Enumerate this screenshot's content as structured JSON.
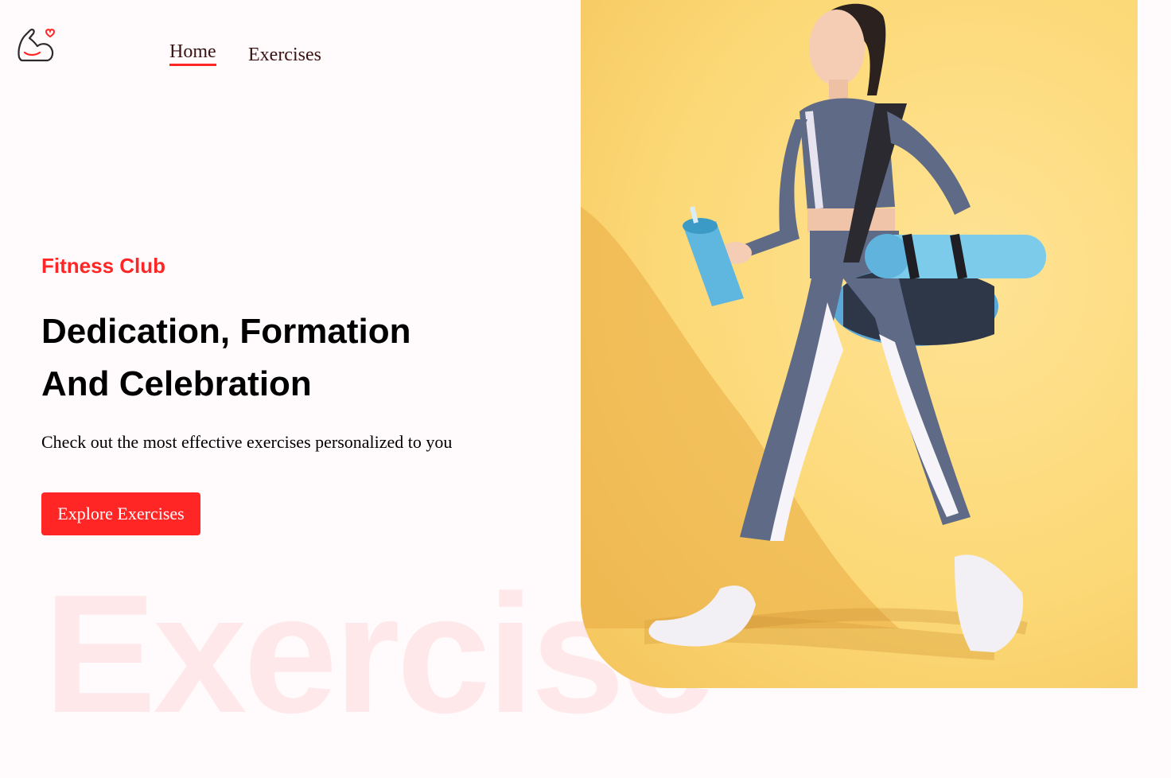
{
  "nav": {
    "items": [
      {
        "label": "Home",
        "active": true
      },
      {
        "label": "Exercises",
        "active": false
      }
    ]
  },
  "hero": {
    "eyebrow": "Fitness Club",
    "headline": "Dedication, Formation And Celebration",
    "subtext": "Check out the most effective exercises personalized to you",
    "cta_label": "Explore Exercises",
    "background_word": "Exercise"
  },
  "colors": {
    "accent": "#ff2625",
    "page_background": "#fffafb",
    "hero_image_background": "#fcd977"
  },
  "icons": {
    "logo": "flexed-arm-heart-icon"
  }
}
